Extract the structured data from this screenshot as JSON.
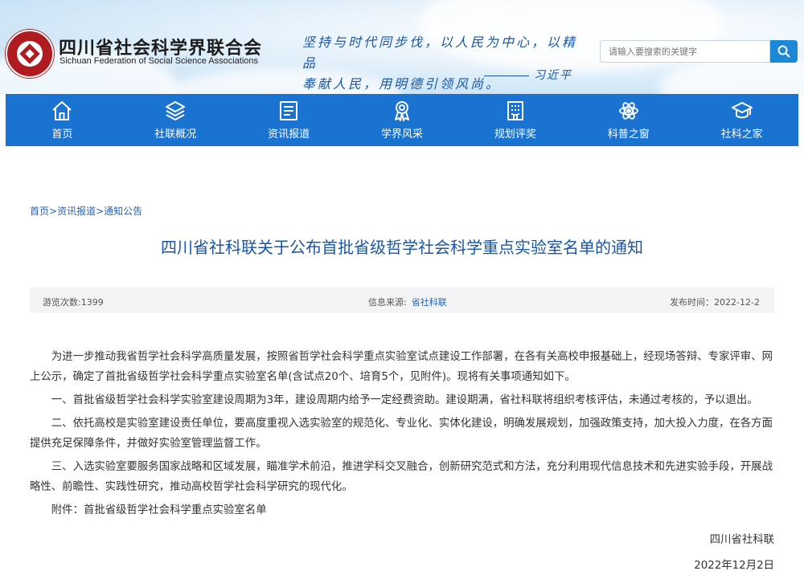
{
  "header": {
    "site_name": "四川省社会科学界联合会",
    "site_name_en": "Sichuan Federation of Social Science Associations",
    "quote_line1": "坚持与时代同步伐，以人民为中心，以精品",
    "quote_line2": "奉献人民，用明德引领风尚。",
    "quote_author": "习近平",
    "search_placeholder": "请输入要搜索的关键字"
  },
  "nav": {
    "items": [
      {
        "label": "首页",
        "icon": "home-icon"
      },
      {
        "label": "社联概况",
        "icon": "layers-icon"
      },
      {
        "label": "资讯报道",
        "icon": "news-icon"
      },
      {
        "label": "学界风采",
        "icon": "award-icon"
      },
      {
        "label": "规划评奖",
        "icon": "building-icon"
      },
      {
        "label": "科普之窗",
        "icon": "atom-icon"
      },
      {
        "label": "社科之家",
        "icon": "graduation-cap-icon"
      }
    ]
  },
  "breadcrumb": {
    "home": "首页",
    "sep1": ">",
    "section": "资讯报道",
    "sep2": ">",
    "subsection": "通知公告"
  },
  "article": {
    "title": "四川省社科联关于公布首批省级哲学社会科学重点实验室名单的通知",
    "meta": {
      "views": "游览次数:1399",
      "source_label": "信息来源:",
      "source": "省社科联",
      "date": "发布时间：2022-12-2"
    },
    "paragraphs": [
      "为进一步推动我省哲学社会科学高质量发展，按照省哲学社会科学重点实验室试点建设工作部署，在各有关高校申报基础上，经现场答辩、专家评审、网上公示，确定了首批省级哲学社会科学重点实验室名单(含试点20个、培育5个，见附件)。现将有关事项通知如下。",
      "一、首批省级哲学社会科学实验室建设周期为3年，建设周期内给予一定经费资助。建设期满，省社科联将组织考核评估，未通过考核的，予以退出。",
      "二、依托高校是实验室建设责任单位，要高度重视入选实验室的规范化、专业化、实体化建设，明确发展规划，加强政策支持，加大投入力度，在各方面提供充足保障条件，并做好实验室管理监督工作。",
      "三、入选实验室要服务国家战略和区域发展，瞄准学术前沿，推进学科交叉融合，创新研究范式和方法，充分利用现代信息技术和先进实验手段，开展战略性、前瞻性、实践性研究，推动高校哲学社会科学研究的现代化。",
      "附件：首批省级哲学社会科学重点实验室名单"
    ],
    "signature": "四川省社科联",
    "sign_date": "2022年12月2日"
  },
  "colors": {
    "nav_bg": "#1a73d1",
    "title_blue": "#1a56a8",
    "link_blue": "#2a64b3",
    "emblem_red": "#b01b22"
  }
}
